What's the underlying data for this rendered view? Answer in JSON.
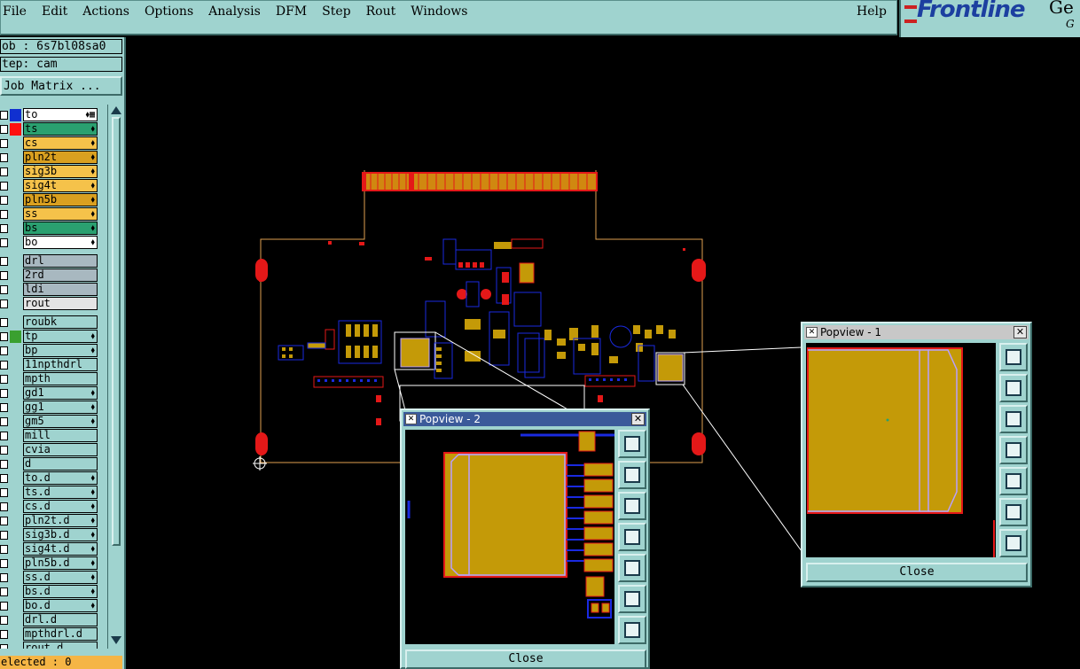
{
  "menu": {
    "items": [
      "File",
      "Edit",
      "Actions",
      "Options",
      "Analysis",
      "DFM",
      "Step",
      "Rout",
      "Windows"
    ],
    "help": "Help"
  },
  "logo": {
    "brand": "Frontline",
    "suffix": "Ge",
    "suffix2": "G"
  },
  "info": {
    "job": "ob : 6s7bl08sa0",
    "step": "tep: cam",
    "job_matrix": "Job Matrix ..."
  },
  "layers": [
    {
      "name": "to",
      "bg": "#ffffff",
      "swatch": "#1030d0",
      "flag": "⬧▦"
    },
    {
      "name": "ts",
      "bg": "#2aa070",
      "swatch": "#ff1010",
      "flag": "⬧"
    },
    {
      "name": "cs",
      "bg": "#f5c24a",
      "swatch": "",
      "flag": "⬧"
    },
    {
      "name": "pln2t",
      "bg": "#d9a020",
      "swatch": "",
      "flag": "⬧"
    },
    {
      "name": "sig3b",
      "bg": "#f5c24a",
      "swatch": "",
      "flag": "⬧"
    },
    {
      "name": "sig4t",
      "bg": "#f5c24a",
      "swatch": "",
      "flag": "⬧"
    },
    {
      "name": "pln5b",
      "bg": "#d9a020",
      "swatch": "",
      "flag": "⬧"
    },
    {
      "name": "ss",
      "bg": "#f5c24a",
      "swatch": "",
      "flag": "⬧"
    },
    {
      "name": "bs",
      "bg": "#2aa070",
      "swatch": "",
      "flag": "⬧"
    },
    {
      "name": "bo",
      "bg": "#ffffff",
      "swatch": "",
      "flag": "⬧"
    },
    {
      "name": "drl",
      "bg": "#a8b8c0",
      "swatch": "",
      "flag": "",
      "gap": true
    },
    {
      "name": "2rd",
      "bg": "#a8b8c0",
      "swatch": "",
      "flag": ""
    },
    {
      "name": "ldi",
      "bg": "#a8b8c0",
      "swatch": "",
      "flag": ""
    },
    {
      "name": "rout",
      "bg": "#e4e4e4",
      "swatch": "",
      "flag": ""
    },
    {
      "name": "roubk",
      "bg": "#9fd3cf",
      "swatch": "",
      "flag": "",
      "gap": true
    },
    {
      "name": "tp",
      "bg": "#9fd3cf",
      "swatch": "#3aa030",
      "flag": "⬧"
    },
    {
      "name": "bp",
      "bg": "#9fd3cf",
      "swatch": "",
      "flag": "⬧"
    },
    {
      "name": "11npthdrl",
      "bg": "#9fd3cf",
      "swatch": "",
      "flag": ""
    },
    {
      "name": "mpth",
      "bg": "#9fd3cf",
      "swatch": "",
      "flag": ""
    },
    {
      "name": "gd1",
      "bg": "#9fd3cf",
      "swatch": "",
      "flag": "⬧"
    },
    {
      "name": "gg1",
      "bg": "#9fd3cf",
      "swatch": "",
      "flag": "⬧"
    },
    {
      "name": "gm5",
      "bg": "#9fd3cf",
      "swatch": "",
      "flag": "⬧"
    },
    {
      "name": "mill",
      "bg": "#9fd3cf",
      "swatch": "",
      "flag": ""
    },
    {
      "name": "cvia",
      "bg": "#9fd3cf",
      "swatch": "",
      "flag": ""
    },
    {
      "name": "d",
      "bg": "#9fd3cf",
      "swatch": "",
      "flag": ""
    },
    {
      "name": "to.d",
      "bg": "#9fd3cf",
      "swatch": "",
      "flag": "⬧"
    },
    {
      "name": "ts.d",
      "bg": "#9fd3cf",
      "swatch": "",
      "flag": "⬧"
    },
    {
      "name": "cs.d",
      "bg": "#9fd3cf",
      "swatch": "",
      "flag": "⬧"
    },
    {
      "name": "pln2t.d",
      "bg": "#9fd3cf",
      "swatch": "",
      "flag": "⬧"
    },
    {
      "name": "sig3b.d",
      "bg": "#9fd3cf",
      "swatch": "",
      "flag": "⬧"
    },
    {
      "name": "sig4t.d",
      "bg": "#9fd3cf",
      "swatch": "",
      "flag": "⬧"
    },
    {
      "name": "pln5b.d",
      "bg": "#9fd3cf",
      "swatch": "",
      "flag": "⬧"
    },
    {
      "name": "ss.d",
      "bg": "#9fd3cf",
      "swatch": "",
      "flag": "⬧"
    },
    {
      "name": "bs.d",
      "bg": "#9fd3cf",
      "swatch": "",
      "flag": "⬧"
    },
    {
      "name": "bo.d",
      "bg": "#9fd3cf",
      "swatch": "",
      "flag": "⬧"
    },
    {
      "name": "drl.d",
      "bg": "#9fd3cf",
      "swatch": "",
      "flag": ""
    },
    {
      "name": "mpthdrl.d",
      "bg": "#9fd3cf",
      "swatch": "",
      "flag": ""
    },
    {
      "name": "rout.d",
      "bg": "#9fd3cf",
      "swatch": "",
      "flag": ""
    }
  ],
  "status": "elected : 0",
  "popview1": {
    "title": "Popview - 1",
    "close_label": "Close"
  },
  "popview2": {
    "title": "Popview - 2",
    "close_label": "Close"
  },
  "colors": {
    "panel": "#9fd3cf",
    "pcb_pad": "#c49a08",
    "pcb_trace": "#1a2ae0",
    "pcb_red": "#e41818",
    "board_outline": "#e0a050"
  }
}
